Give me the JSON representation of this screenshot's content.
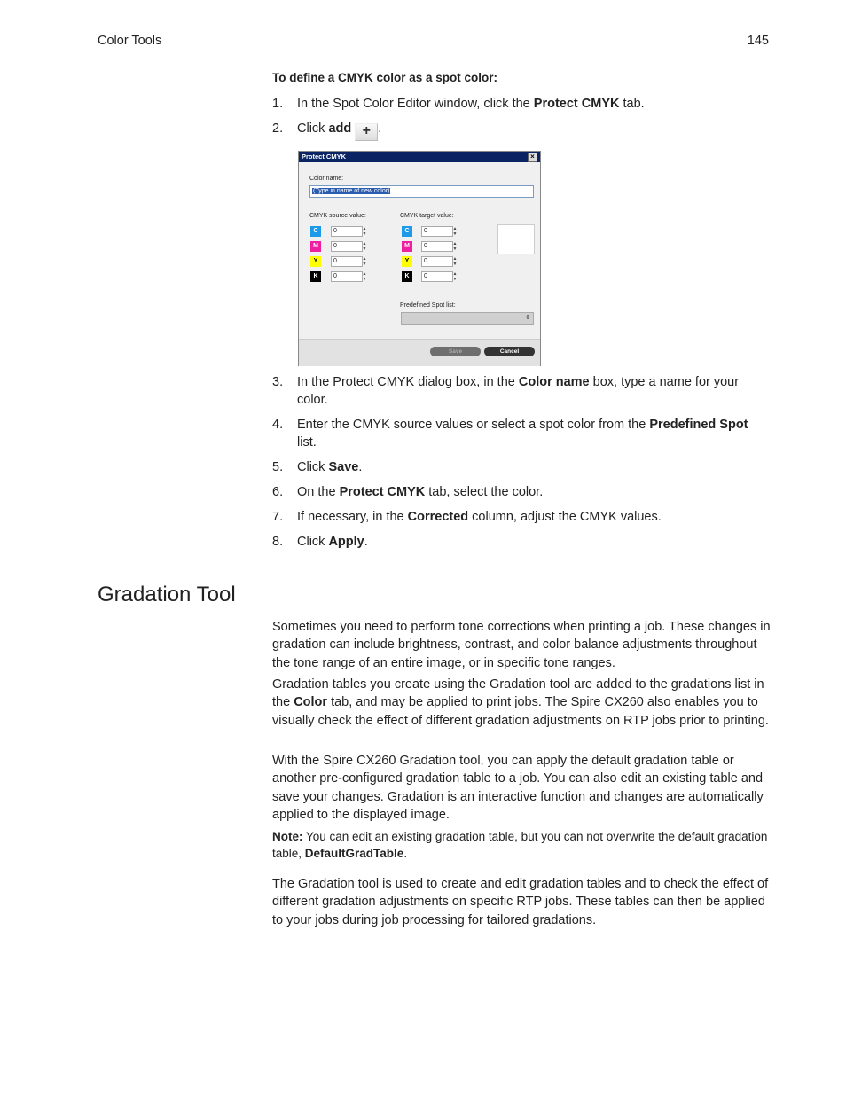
{
  "header": {
    "section": "Color Tools",
    "page_number": "145"
  },
  "procedure": {
    "title": "To define a CMYK color as a spot color:",
    "steps": [
      {
        "num": "1.",
        "pre": "In the Spot Color Editor window, click the ",
        "bold": "Protect CMYK",
        "post": " tab."
      },
      {
        "num": "2.",
        "pre": "Click ",
        "bold": "add",
        "post": ".",
        "icon": "plus-icon"
      },
      {
        "num": "3.",
        "pre": "In the Protect CMYK dialog box, in the ",
        "bold": "Color name",
        "post": " box, type a name for your color."
      },
      {
        "num": "4.",
        "pre": "Enter the CMYK source values or select a spot color from the ",
        "bold": "Predefined Spot",
        "post": " list."
      },
      {
        "num": "5.",
        "pre": "Click ",
        "bold": "Save",
        "post": "."
      },
      {
        "num": "6.",
        "pre": "On the ",
        "bold": "Protect CMYK",
        "post": " tab, select the color."
      },
      {
        "num": "7.",
        "pre": "If necessary, in the ",
        "bold": "Corrected",
        "post": " column, adjust the CMYK values."
      },
      {
        "num": "8.",
        "pre": "Click ",
        "bold": "Apply",
        "post": "."
      }
    ]
  },
  "dialog": {
    "title": "Protect CMYK",
    "color_name_label": "Color name:",
    "color_name_value": "(Type in name of new color)",
    "source_label": "CMYK source value:",
    "target_label": "CMYK target value:",
    "channels": [
      {
        "letter": "C",
        "color": "#1e9be8",
        "source": "0",
        "target": "0"
      },
      {
        "letter": "M",
        "color": "#ee1fa0",
        "source": "0",
        "target": "0"
      },
      {
        "letter": "Y",
        "color": "#ffff00",
        "source": "0",
        "target": "0"
      },
      {
        "letter": "K",
        "color": "#000000",
        "source": "0",
        "target": "0"
      }
    ],
    "predefined_label": "Predefined Spot list:",
    "predefined_value": "",
    "save_label": "Save",
    "cancel_label": "Cancel"
  },
  "section": {
    "heading": "Gradation Tool",
    "p1": "Sometimes you need to perform tone corrections when printing a job. These changes in gradation can include brightness, contrast, and color balance adjustments throughout the tone range of an entire image, or in specific tone ranges.",
    "p2_pre": "Gradation tables you create using the Gradation tool are added to the gradations list in the ",
    "p2_bold": "Color",
    "p2_post": " tab, and may be applied to print jobs. The Spire CX260 also enables you to visually check the effect of different gradation adjustments on RTP jobs prior to printing.",
    "p3": "With the Spire CX260 Gradation tool, you can apply the default gradation table or another pre-configured gradation table to a job. You can also edit an existing table and save your changes. Gradation is an interactive function and changes are automatically applied to the displayed image.",
    "note_label": "Note:",
    "note_pre": " You can edit an existing gradation table, but you can not overwrite the default gradation table, ",
    "note_bold": "DefaultGradTable",
    "note_post": ".",
    "p4": "The Gradation tool is used to create and edit gradation tables and to check the effect of different gradation adjustments on specific RTP jobs. These tables can then be applied to your jobs during job processing for tailored gradations."
  }
}
